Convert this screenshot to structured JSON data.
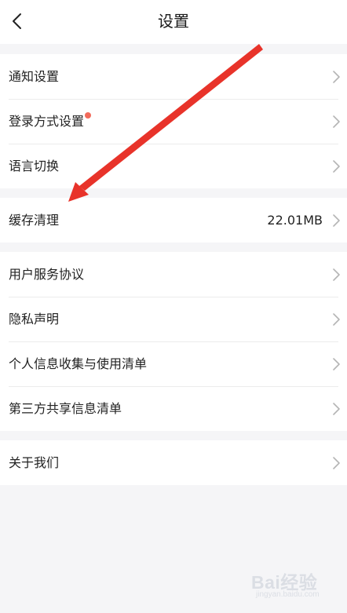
{
  "header": {
    "title": "设置"
  },
  "groups": [
    {
      "items": [
        {
          "label": "通知设置"
        },
        {
          "label": "登录方式设置",
          "badge_color": "#f26b5b"
        },
        {
          "label": "语言切换"
        }
      ]
    },
    {
      "items": [
        {
          "label": "缓存清理",
          "value": "22.01MB"
        }
      ]
    },
    {
      "items": [
        {
          "label": "用户服务协议"
        },
        {
          "label": "隐私声明"
        },
        {
          "label": "个人信息收集与使用清单"
        },
        {
          "label": "第三方共享信息清单"
        }
      ]
    },
    {
      "items": [
        {
          "label": "关于我们"
        }
      ]
    }
  ],
  "watermark": {
    "text": "Bai经验",
    "subtext": "jingyan.baidu.com"
  },
  "colors": {
    "background": "#f5f5f7",
    "chevron": "#b5b5b5",
    "annotation_arrow": "#e8332a",
    "badge": "#f26b5b"
  },
  "icons": {
    "back": "chevron-left-icon",
    "row": "chevron-right-icon"
  }
}
